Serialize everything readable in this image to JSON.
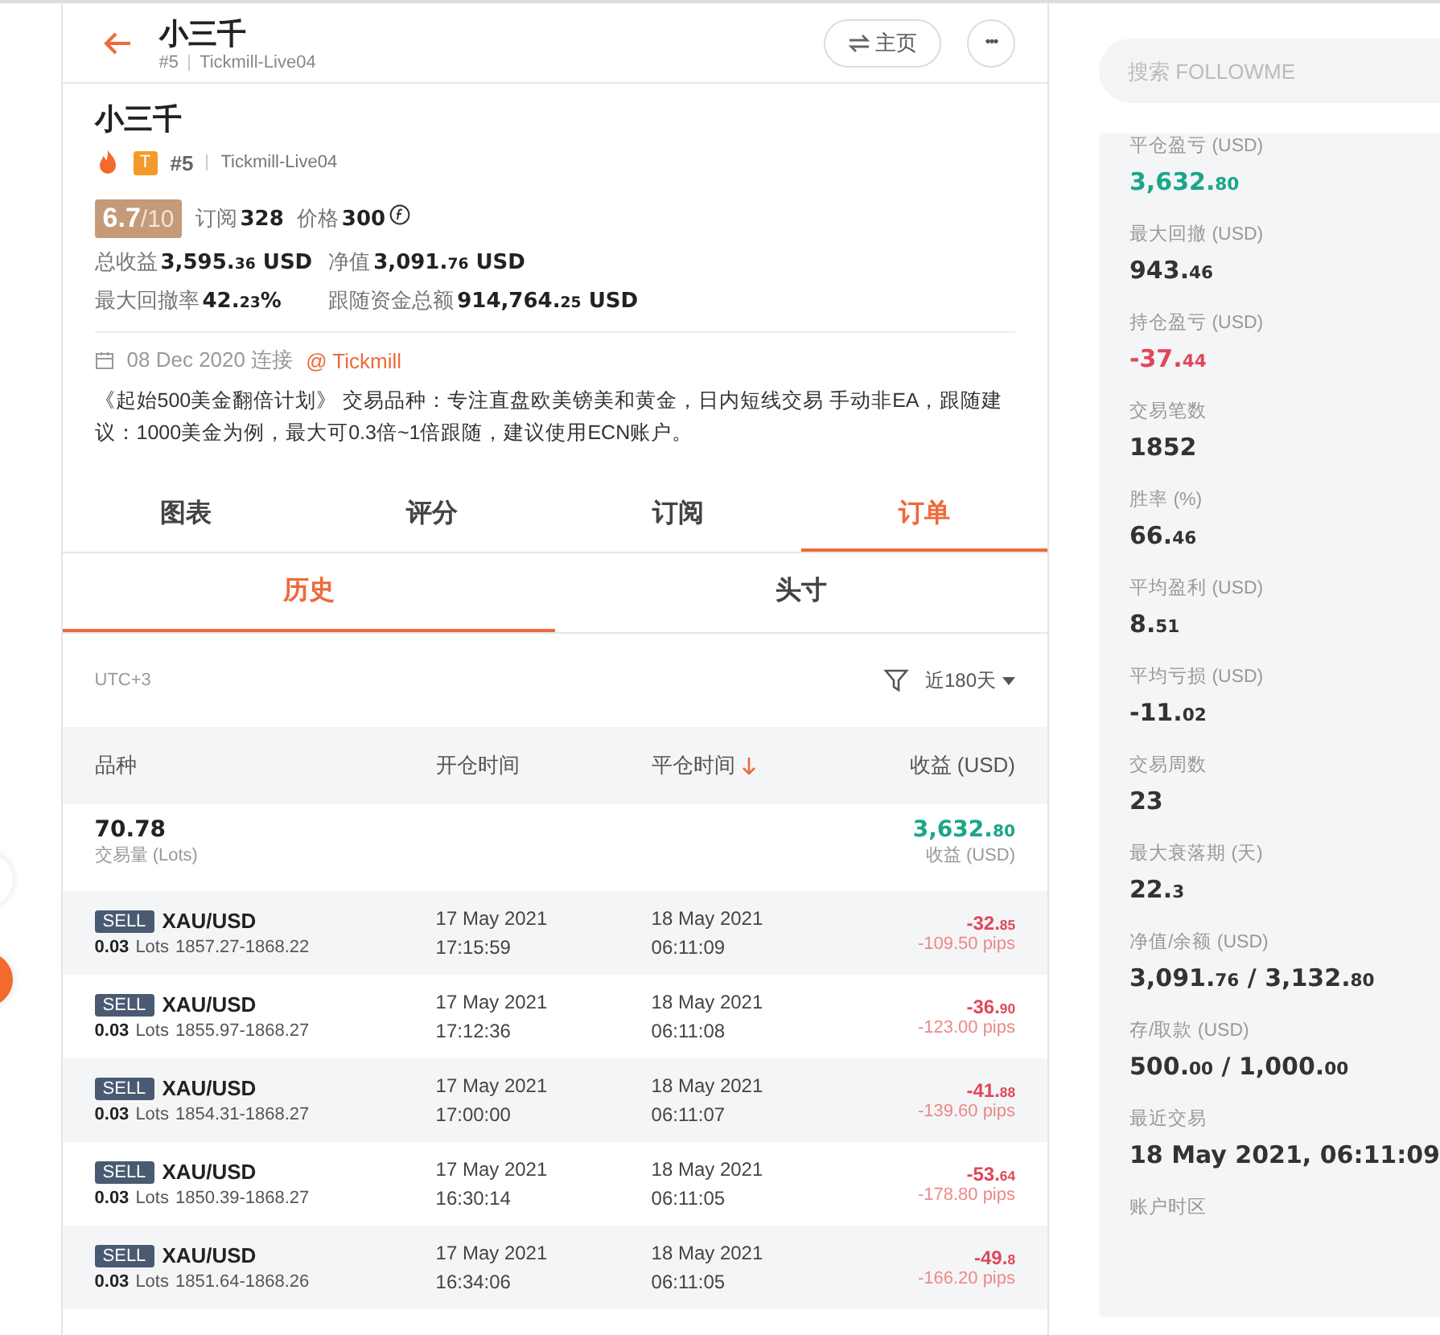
{
  "header": {
    "title": "小三千",
    "rank": "#5",
    "server": "Tickmill-Live04",
    "home_button": "主页",
    "more_button": "•••"
  },
  "profile": {
    "name": "小三千",
    "badge_letter": "T",
    "rank": "#5",
    "server": "Tickmill-Live04",
    "score": "6.7",
    "score_max": "/10",
    "subs_label": "订阅",
    "subs": "328",
    "price_label": "价格",
    "price": "300",
    "stats": [
      {
        "label": "总收益",
        "value": "3,595.36 USD"
      },
      {
        "label": "净值",
        "value": "3,091.76 USD"
      },
      {
        "label": "最大回撤率",
        "value": "42.23%"
      },
      {
        "label": "跟随资金总额",
        "value": "914,764.25 USD"
      }
    ],
    "since": "08 Dec 2020 连接",
    "broker_link": "@ Tickmill",
    "description": "《起始500美金翻倍计划》 交易品种：专注直盘欧美镑美和黄金，日内短线交易 手动非EA，跟随建议：1000美金为例，最大可0.3倍~1倍跟随，建议使用ECN账户。"
  },
  "tabs": [
    {
      "label": "图表",
      "selected": false
    },
    {
      "label": "评分",
      "selected": false
    },
    {
      "label": "订阅",
      "selected": false
    },
    {
      "label": "订单",
      "selected": true
    }
  ],
  "subtabs": [
    {
      "label": "历史",
      "selected": true
    },
    {
      "label": "头寸",
      "selected": false
    }
  ],
  "filter": {
    "timezone": "UTC+3",
    "range": "近180天"
  },
  "table": {
    "columns": [
      {
        "label": "品种",
        "sorted": false
      },
      {
        "label": "开仓时间",
        "sorted": false
      },
      {
        "label": "平仓时间",
        "sorted": true
      },
      {
        "label": "收益 (USD)",
        "sorted": false
      }
    ],
    "summary": {
      "volume": "70.78",
      "volume_label": "交易量 (Lots)",
      "profit": "3,632.80",
      "profit_label": "收益 (USD)"
    },
    "rows": [
      {
        "side": "SELL",
        "symbol": "XAU/USD",
        "lots": "0.03",
        "lots_unit": "Lots",
        "prices": "1857.27-1868.22",
        "open_date": "17 May 2021",
        "open_time": "17:15:59",
        "close_date": "18 May 2021",
        "close_time": "06:11:09",
        "profit": "-32.85",
        "pips": "-109.50 pips"
      },
      {
        "side": "SELL",
        "symbol": "XAU/USD",
        "lots": "0.03",
        "lots_unit": "Lots",
        "prices": "1855.97-1868.27",
        "open_date": "17 May 2021",
        "open_time": "17:12:36",
        "close_date": "18 May 2021",
        "close_time": "06:11:08",
        "profit": "-36.90",
        "pips": "-123.00 pips"
      },
      {
        "side": "SELL",
        "symbol": "XAU/USD",
        "lots": "0.03",
        "lots_unit": "Lots",
        "prices": "1854.31-1868.27",
        "open_date": "17 May 2021",
        "open_time": "17:00:00",
        "close_date": "18 May 2021",
        "close_time": "06:11:07",
        "profit": "-41.88",
        "pips": "-139.60 pips"
      },
      {
        "side": "SELL",
        "symbol": "XAU/USD",
        "lots": "0.03",
        "lots_unit": "Lots",
        "prices": "1850.39-1868.27",
        "open_date": "17 May 2021",
        "open_time": "16:30:14",
        "close_date": "18 May 2021",
        "close_time": "06:11:05",
        "profit": "-53.64",
        "pips": "-178.80 pips"
      },
      {
        "side": "SELL",
        "symbol": "XAU/USD",
        "lots": "0.03",
        "lots_unit": "Lots",
        "prices": "1851.64-1868.26",
        "open_date": "17 May 2021",
        "open_time": "16:34:06",
        "close_date": "18 May 2021",
        "close_time": "06:11:05",
        "profit": "-49.8",
        "pips": "-166.20 pips"
      }
    ]
  },
  "sidebar": {
    "search": {
      "placeholder": "搜索 FOLLOWME"
    },
    "stats": [
      {
        "label": "平仓盈亏 (USD)",
        "value": "3,632.80",
        "color": "#1aa68a"
      },
      {
        "label": "最大回撤 (USD)",
        "value": "943.46",
        "color": "#333333"
      },
      {
        "label": "持仓盈亏 (USD)",
        "value": "-37.44",
        "color": "#e0475a"
      },
      {
        "label": "交易笔数",
        "value": "1852",
        "color": "#333333"
      },
      {
        "label": "胜率 (%)",
        "value": "66.46",
        "color": "#333333"
      },
      {
        "label": "平均盈利 (USD)",
        "value": "8.51",
        "color": "#333333"
      },
      {
        "label": "平均亏损 (USD)",
        "value": "-11.02",
        "color": "#333333"
      },
      {
        "label": "交易周数",
        "value": "23",
        "color": "#333333"
      },
      {
        "label": "最大衰落期 (天)",
        "value": "22.3",
        "color": "#333333"
      },
      {
        "label": "净值/余额 (USD)",
        "value": "3,091.76 / 3,132.80",
        "color": "#333333"
      },
      {
        "label": "存/取款 (USD)",
        "value": "500.00 / 1,000.00",
        "color": "#333333"
      },
      {
        "label": "最近交易",
        "value": "18 May 2021, 06:11:09",
        "color": "#333333"
      },
      {
        "label": "账户时区"
      }
    ]
  }
}
